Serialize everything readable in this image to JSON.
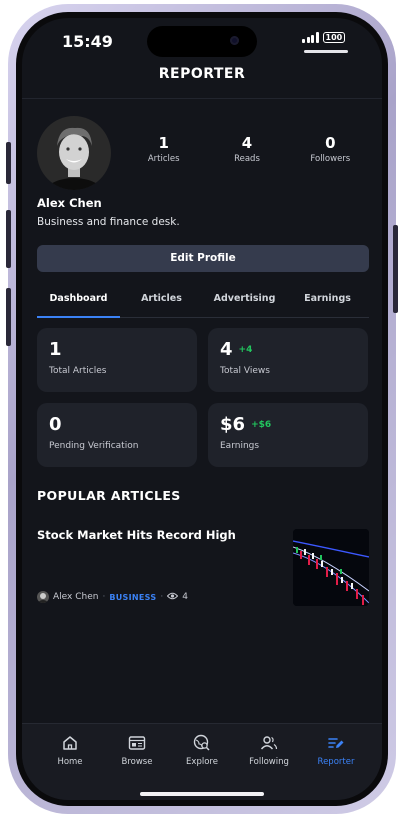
{
  "status": {
    "time": "15:49",
    "battery": "100"
  },
  "header": {
    "title": "REPORTER"
  },
  "profile": {
    "name": "Alex Chen",
    "bio": "Business and finance desk.",
    "stats": [
      {
        "value": "1",
        "label": "Articles"
      },
      {
        "value": "4",
        "label": "Reads"
      },
      {
        "value": "0",
        "label": "Followers"
      }
    ],
    "edit_label": "Edit Profile"
  },
  "tabs": [
    "Dashboard",
    "Articles",
    "Advertising",
    "Earnings"
  ],
  "active_tab": "Dashboard",
  "cards": [
    {
      "value": "1",
      "delta": "",
      "label": "Total Articles"
    },
    {
      "value": "4",
      "delta": "+4",
      "label": "Total Views"
    },
    {
      "value": "0",
      "delta": "",
      "label": "Pending Verification"
    },
    {
      "value": "$6",
      "delta": "+$6",
      "label": "Earnings"
    }
  ],
  "popular": {
    "section_title": "POPULAR ARTICLES",
    "article": {
      "title": "Stock Market Hits Record High",
      "author": "Alex Chen",
      "category": "BUSINESS",
      "views": "4"
    }
  },
  "nav": {
    "items": [
      {
        "label": "Home",
        "icon": "home-icon"
      },
      {
        "label": "Browse",
        "icon": "browse-icon"
      },
      {
        "label": "Explore",
        "icon": "explore-icon"
      },
      {
        "label": "Following",
        "icon": "following-icon"
      },
      {
        "label": "Reporter",
        "icon": "reporter-icon"
      }
    ],
    "active": "Reporter"
  },
  "colors": {
    "accent": "#3b82f6",
    "positive": "#22c55e",
    "background": "#13151b",
    "card": "#1f222a"
  }
}
